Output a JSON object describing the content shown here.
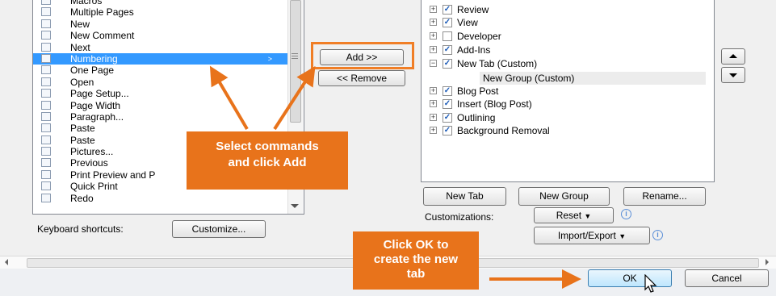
{
  "commands": [
    {
      "label": "Macros",
      "icon": "macros-icon",
      "selected": false
    },
    {
      "label": "Multiple Pages",
      "icon": "multiple-pages-icon",
      "selected": false
    },
    {
      "label": "New",
      "icon": "new-document-icon",
      "selected": false
    },
    {
      "label": "New Comment",
      "icon": "new-comment-icon",
      "selected": false
    },
    {
      "label": "Next",
      "icon": "next-icon",
      "selected": false
    },
    {
      "label": "Numbering",
      "icon": "numbering-icon",
      "selected": true,
      "submenu": ">"
    },
    {
      "label": "One Page",
      "icon": "one-page-icon",
      "selected": false
    },
    {
      "label": "Open",
      "icon": "open-folder-icon",
      "selected": false
    },
    {
      "label": "Page Setup...",
      "icon": "page-setup-icon",
      "selected": false
    },
    {
      "label": "Page Width",
      "icon": "page-width-icon",
      "selected": false
    },
    {
      "label": "Paragraph...",
      "icon": "paragraph-icon",
      "selected": false
    },
    {
      "label": "Paste",
      "icon": "paste-icon",
      "selected": false
    },
    {
      "label": "Paste",
      "icon": "paste-icon",
      "selected": false
    },
    {
      "label": "Pictures...",
      "icon": "pictures-icon",
      "selected": false
    },
    {
      "label": "Previous",
      "icon": "previous-icon",
      "selected": false
    },
    {
      "label": "Print Preview and P",
      "icon": "print-preview-icon",
      "selected": false
    },
    {
      "label": "Quick Print",
      "icon": "quick-print-icon",
      "selected": false
    },
    {
      "label": "Redo",
      "icon": "redo-icon",
      "selected": false
    }
  ],
  "buttons": {
    "add": "Add >>",
    "remove": "<< Remove",
    "new_tab": "New Tab",
    "new_group": "New Group",
    "rename": "Rename...",
    "reset": "Reset",
    "import_export": "Import/Export",
    "customize": "Customize...",
    "ok": "OK",
    "cancel": "Cancel"
  },
  "labels": {
    "keyboard_shortcuts": "Keyboard shortcuts:",
    "customizations": "Customizations:"
  },
  "tabs_tree": [
    {
      "label": "Review",
      "checked": true,
      "expander": "+",
      "indent": 0,
      "bold": false
    },
    {
      "label": "View",
      "checked": true,
      "expander": "+",
      "indent": 0,
      "bold": false
    },
    {
      "label": "Developer",
      "checked": false,
      "expander": "+",
      "indent": 0,
      "bold": false
    },
    {
      "label": "Add-Ins",
      "checked": true,
      "expander": "+",
      "indent": 0,
      "bold": false
    },
    {
      "label": "New Tab (Custom)",
      "checked": true,
      "expander": "−",
      "indent": 0,
      "bold": false
    },
    {
      "label": "New Group (Custom)",
      "checked": null,
      "expander": "",
      "indent": 1,
      "bold": false
    },
    {
      "label": "Blog Post",
      "checked": true,
      "expander": "+",
      "indent": 0,
      "bold": false
    },
    {
      "label": "Insert (Blog Post)",
      "checked": true,
      "expander": "+",
      "indent": 0,
      "bold": false
    },
    {
      "label": "Outlining",
      "checked": true,
      "expander": "+",
      "indent": 0,
      "bold": false
    },
    {
      "label": "Background Removal",
      "checked": true,
      "expander": "+",
      "indent": 0,
      "bold": false
    }
  ],
  "callouts": {
    "select_add": "Select commands and click Add",
    "ok_hint": "Click OK to create the new tab"
  },
  "colors": {
    "accent_orange": "#e8731b",
    "selection_blue": "#3399ff"
  }
}
